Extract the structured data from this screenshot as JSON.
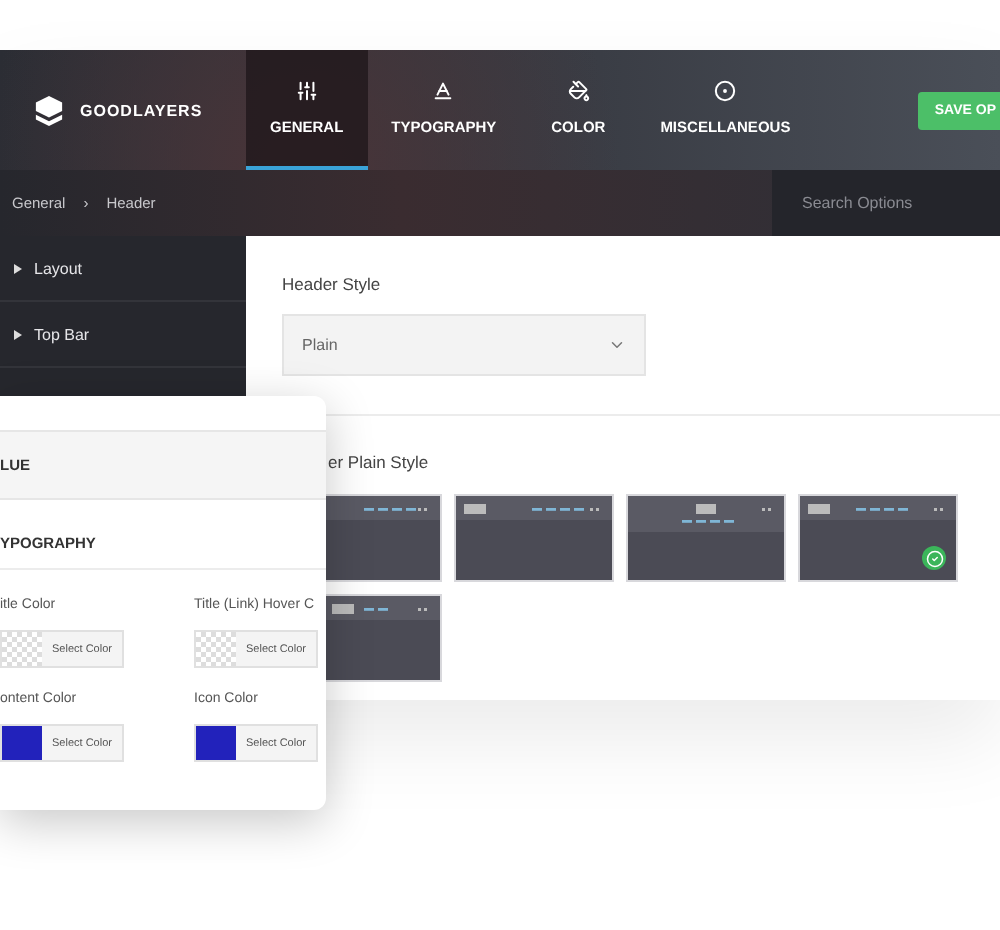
{
  "brand": {
    "name": "GOODLAYERS"
  },
  "tabs": [
    {
      "label": "GENERAL",
      "selected": true
    },
    {
      "label": "TYPOGRAPHY",
      "selected": false
    },
    {
      "label": "COLOR",
      "selected": false
    },
    {
      "label": "MISCELLANEOUS",
      "selected": false
    }
  ],
  "save_button": "SAVE OP",
  "breadcrumb": [
    "General",
    "Header"
  ],
  "breadcrumb_separator": "›",
  "search": {
    "placeholder": "Search Options"
  },
  "sidebar": {
    "items": [
      "Layout",
      "Top Bar"
    ]
  },
  "header_style": {
    "label": "Header Style",
    "value": "Plain"
  },
  "plain_style": {
    "label": "er Plain Style",
    "options": [
      {
        "kind": "right-menu",
        "selected": false
      },
      {
        "kind": "logo-left",
        "selected": false
      },
      {
        "kind": "logo-center",
        "selected": false
      },
      {
        "kind": "menu-center",
        "selected": true
      },
      {
        "kind": "split-menu",
        "selected": false
      }
    ]
  },
  "color_panel": {
    "section": "LUE",
    "group": "YPOGRAPHY",
    "fields": [
      {
        "label": "itle Color",
        "button": "Select Color"
      },
      {
        "label": "Title (Link) Hover C",
        "button": "Select Color"
      },
      {
        "label": "ontent Color",
        "button": "Select Color",
        "color": "#2222bb"
      },
      {
        "label": "Icon Color",
        "button": "Select Color",
        "color": "#2222bb"
      }
    ]
  }
}
